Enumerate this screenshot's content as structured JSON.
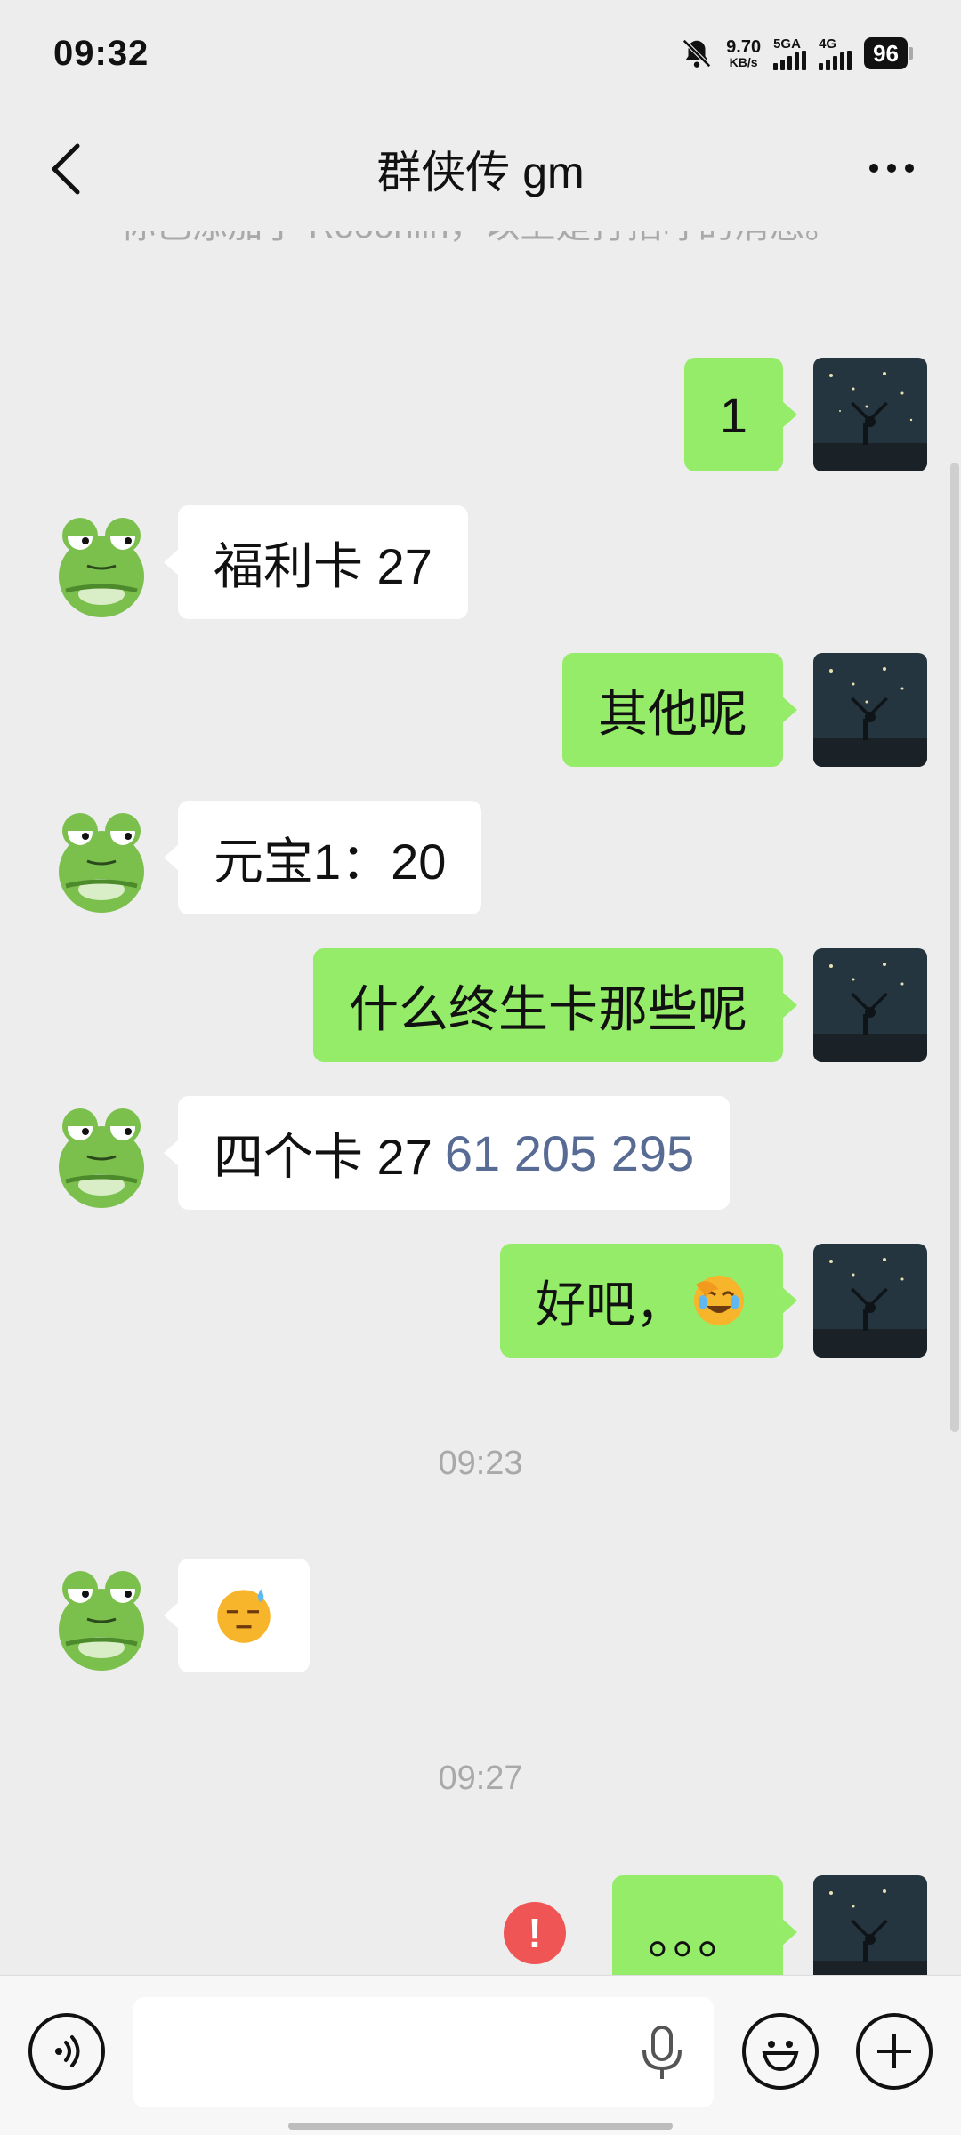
{
  "status_bar": {
    "time": "09:32",
    "net_speed_value": "9.70",
    "net_speed_unit": "KB/s",
    "sim1_label": "5GA",
    "sim2_label": "4G",
    "battery": "96"
  },
  "header": {
    "title": "群侠传 gm",
    "back_icon": "chevron-left-icon",
    "more_icon": "more-dots-icon"
  },
  "chat": {
    "system_text": "你已添加了 Rooonlin，以上是打招呼的消息。",
    "messages": [
      {
        "side": "right",
        "text": "1"
      },
      {
        "side": "left",
        "text": "福利卡 27"
      },
      {
        "side": "right",
        "text": "其他呢"
      },
      {
        "side": "left",
        "text": "元宝1：20"
      },
      {
        "side": "right",
        "text": "什么终生卡那些呢"
      },
      {
        "side": "left",
        "text": "四个卡 27",
        "link_text": "61 205 295"
      },
      {
        "side": "right",
        "text": "好吧，",
        "emoji": "facepalm-laugh-emoji"
      },
      {
        "side": "left",
        "emoji": "sweat-expressionless-emoji"
      },
      {
        "side": "right",
        "text": "。。。",
        "status": "send-failed"
      }
    ],
    "timestamps": [
      "09:23",
      "09:27"
    ]
  },
  "input_bar": {
    "voice_icon": "voice-icon",
    "mic_icon": "mic-icon",
    "emoji_icon": "emoji-icon",
    "plus_icon": "plus-icon",
    "value": ""
  },
  "colors": {
    "background": "#ededed",
    "bubble_sent": "#95ec69",
    "bubble_received": "#ffffff",
    "link": "#576b95",
    "error": "#f05556"
  }
}
